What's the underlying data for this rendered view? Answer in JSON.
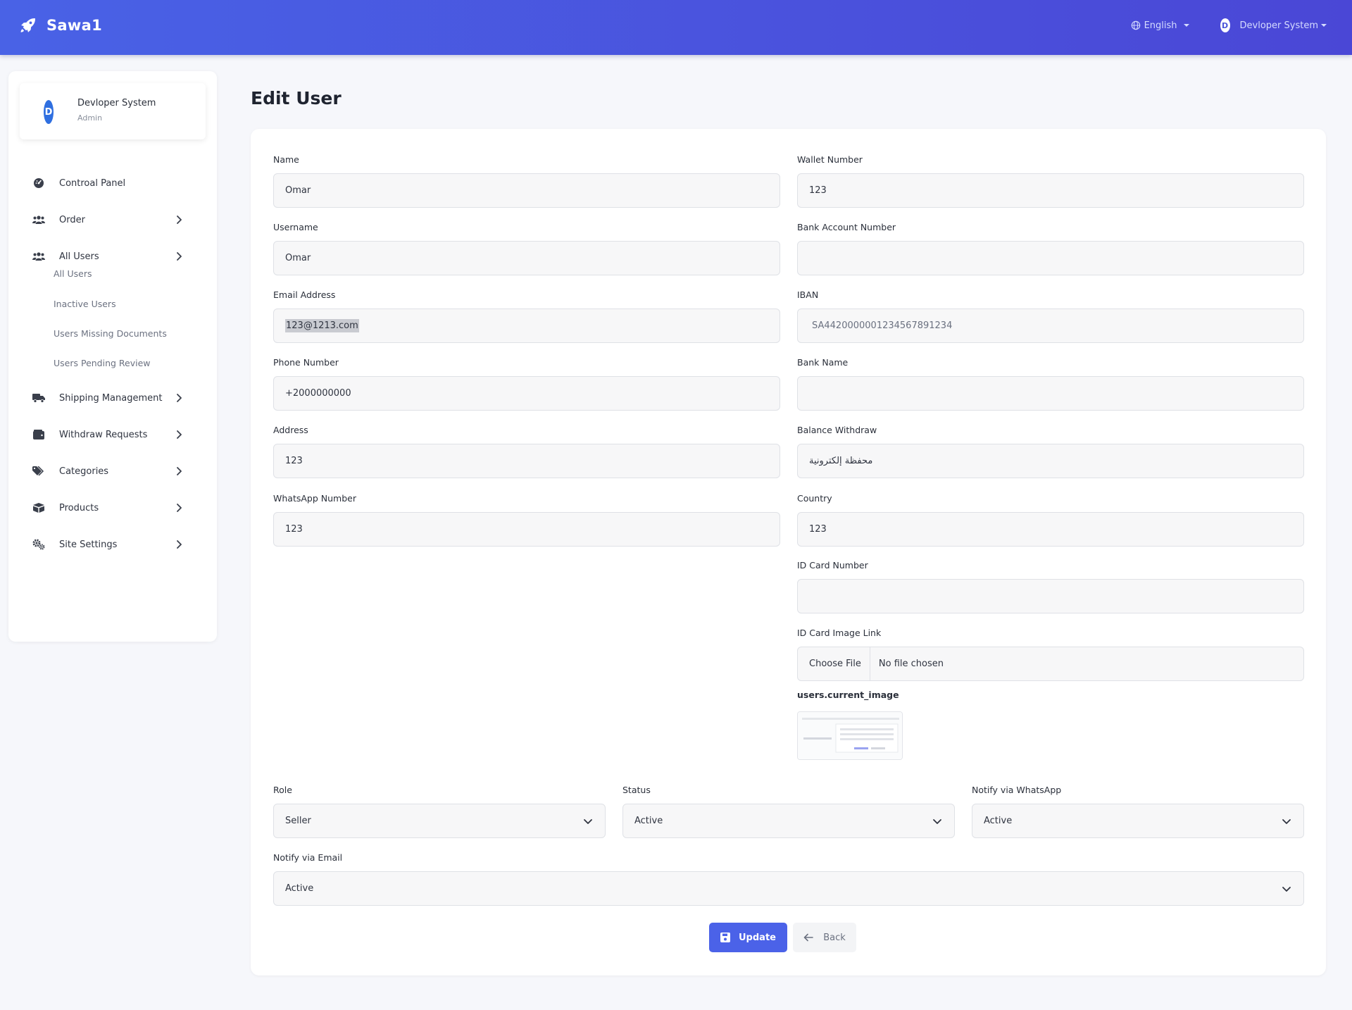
{
  "header": {
    "brand": "Sawa1",
    "language": "English",
    "user_name": "Devloper System",
    "avatar_letter": "D"
  },
  "sidebar": {
    "profile": {
      "avatar_letter": "D",
      "name": "Devloper System",
      "role": "Admin"
    },
    "items": [
      {
        "label": "Controal Panel",
        "icon": "dashboard-icon",
        "has_chevron": false
      },
      {
        "label": "Order",
        "icon": "users-icon",
        "has_chevron": true
      },
      {
        "label": "All Users",
        "icon": "users-icon",
        "has_chevron": true
      },
      {
        "label": "Shipping Management",
        "icon": "truck-icon",
        "has_chevron": true
      },
      {
        "label": "Withdraw Requests",
        "icon": "wallet-icon",
        "has_chevron": true
      },
      {
        "label": "Categories",
        "icon": "tags-icon",
        "has_chevron": true
      },
      {
        "label": "Products",
        "icon": "box-icon",
        "has_chevron": true
      },
      {
        "label": "Site Settings",
        "icon": "gears-icon",
        "has_chevron": true
      }
    ],
    "subitems": [
      "All Users",
      "Inactive Users",
      "Users Missing Documents",
      "Users Pending Review"
    ]
  },
  "page": {
    "title": "Edit User"
  },
  "form": {
    "name": {
      "label": "Name",
      "value": "Omar"
    },
    "username": {
      "label": "Username",
      "value": "Omar"
    },
    "email": {
      "label": "Email Address",
      "value": "123@1213.com"
    },
    "phone": {
      "label": "Phone Number",
      "value": "+2000000000"
    },
    "address": {
      "label": "Address",
      "value": "123"
    },
    "whatsapp": {
      "label": "WhatsApp Number",
      "value": "123"
    },
    "wallet": {
      "label": "Wallet Number",
      "value": "123"
    },
    "bank_account": {
      "label": "Bank Account Number",
      "value": ""
    },
    "iban": {
      "label": "IBAN",
      "placeholder": "SA4420000001234567891234"
    },
    "bank_name": {
      "label": "Bank Name",
      "value": ""
    },
    "balance_withdraw": {
      "label": "Balance Withdraw",
      "value": "محفظة إلكترونية"
    },
    "country": {
      "label": "Country",
      "value": "123"
    },
    "id_card_number": {
      "label": "ID Card Number",
      "value": ""
    },
    "id_card_image": {
      "label": "ID Card Image Link",
      "button": "Choose File",
      "status": "No file chosen"
    },
    "current_image_label": "users.current_image",
    "role": {
      "label": "Role",
      "value": "Seller"
    },
    "status": {
      "label": "Status",
      "value": "Active"
    },
    "notify_whatsapp": {
      "label": "Notify via WhatsApp",
      "value": "Active"
    },
    "notify_email": {
      "label": "Notify via Email",
      "value": "Active"
    }
  },
  "actions": {
    "update": "Update",
    "back": "Back"
  },
  "colors": {
    "header_start": "#4962e6",
    "header_end": "#4a47d6",
    "primary": "#4b62e8",
    "background": "#f6f7fb"
  }
}
